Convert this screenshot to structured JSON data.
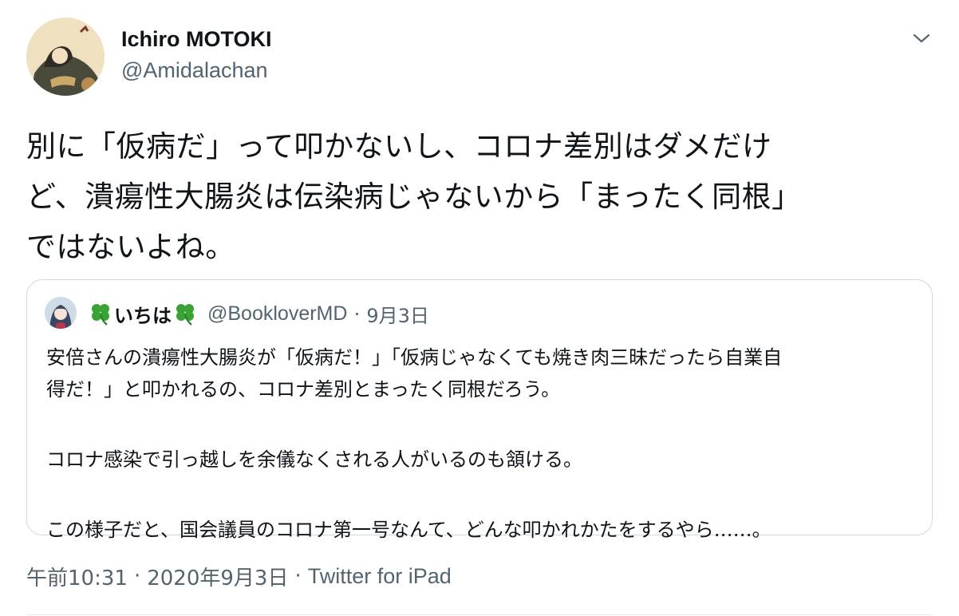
{
  "author": {
    "name": "Ichiro MOTOKI",
    "handle": "@Amidalachan"
  },
  "tweet": {
    "lines": [
      "別に「仮病だ」って叩かないし、コロナ差別はダメだけ",
      "ど、潰瘍性大腸炎は伝染病じゃないから「まったく同根」",
      "ではないよね。"
    ]
  },
  "quoted": {
    "name": "いちは",
    "handle": "@BookloverMD",
    "separator": "·",
    "date": "9月3日",
    "lines": [
      "安倍さんの潰瘍性大腸炎が「仮病だ！」「仮病じゃなくても焼き肉三昧だったら自業自",
      "得だ！」と叩かれるの、コロナ差別とまったく同根だろう。",
      "コロナ感染で引っ越しを余儀なくされる人がいるのも頷ける。",
      "この様子だと、国会議員のコロナ第一号なんて、どんな叩かれかたをするやら……。"
    ]
  },
  "meta": {
    "time": "午前10:31",
    "date": "2020年9月3日",
    "separator": "·",
    "source": "Twitter for iPad"
  },
  "icons": {
    "more": "chevron-down-icon",
    "clover": "four-leaf-clover-icon"
  },
  "colors": {
    "text": "#0f1419",
    "secondary": "#536471",
    "border": "#cfd9de",
    "clover": "#3aa335"
  }
}
